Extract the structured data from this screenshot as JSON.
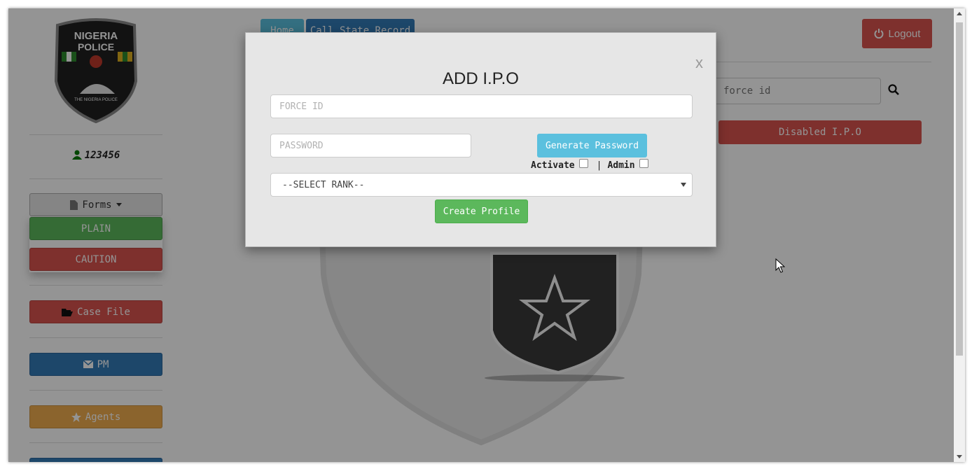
{
  "sidebar": {
    "logo_text": {
      "top": "NIGERIA",
      "middle": "POLICE",
      "bottom": "THE NIGERIA POLICE"
    },
    "user_id": "123456",
    "forms_label": "Forms",
    "dropdown": {
      "plain": "PLAIN",
      "caution": "CAUTION"
    },
    "case_file": "Case File",
    "pm": "PM",
    "agents": "Agents"
  },
  "header": {
    "tabs": [
      "Home",
      "Call State Record"
    ],
    "logout": "Logout",
    "search_placeholder": "force id",
    "disabled_ipo": "Disabled I.P.O"
  },
  "modal": {
    "title": "ADD I.P.O",
    "close": "x",
    "force_id_placeholder": "FORCE ID",
    "password_placeholder": "PASSWORD",
    "generate_password": "Generate Password",
    "activate_label": "Activate",
    "separator": "|",
    "admin_label": "Admin",
    "rank_selected": "--SELECT RANK--",
    "create_profile": "Create Profile"
  },
  "colors": {
    "danger": "#d9534f",
    "primary": "#337ab7",
    "success": "#5cb85c",
    "info": "#5bc0de",
    "warning": "#f0ad4e"
  }
}
